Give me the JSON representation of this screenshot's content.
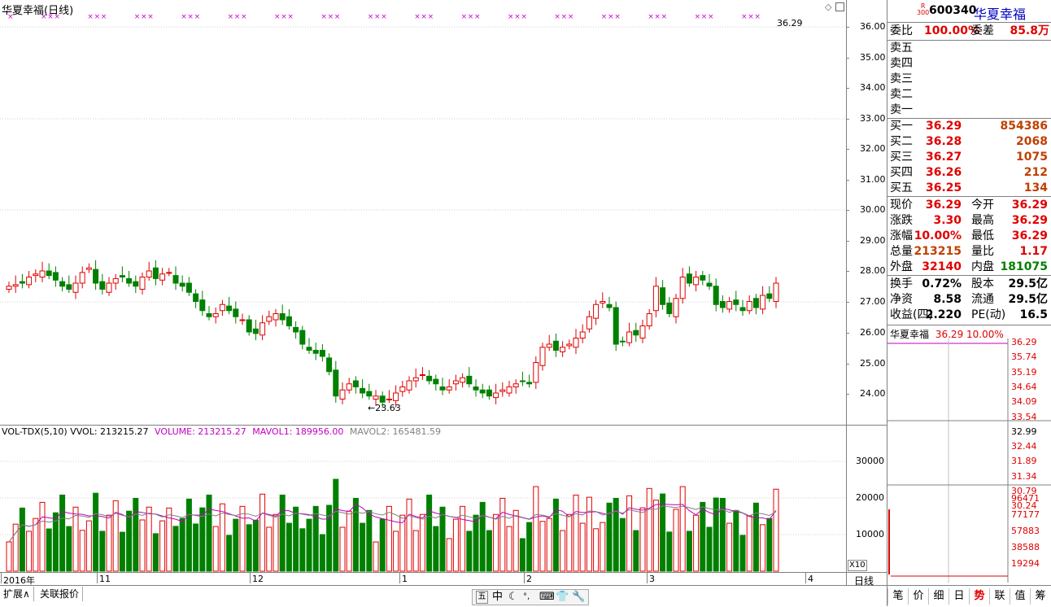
{
  "chart_title": "华夏幸福(日线)",
  "price_axis": [
    "36.00",
    "35.00",
    "34.00",
    "33.00",
    "32.00",
    "31.00",
    "30.00",
    "29.00",
    "28.00",
    "27.00",
    "26.00",
    "25.00",
    "24.00"
  ],
  "vol_axis": [
    "30000",
    "20000",
    "10000"
  ],
  "vol_scale_label": "X10",
  "hi_label": "36.29",
  "lo_label": "←23.63",
  "vol_indicator": {
    "name": "VOL-TDX(5,10)",
    "vvol": "VVOL: 213215.27",
    "volume": "VOLUME: 213215.27",
    "mavol1": "MAVOL1: 189956.00",
    "mavol2": "MAVOL2: 165481.59"
  },
  "x_labels": [
    "2016年",
    "11",
    "12",
    "1",
    "2",
    "3",
    "4"
  ],
  "period_label": "日线",
  "bottom_tabs": [
    "扩展∧",
    "关联报价"
  ],
  "toolbar_icons": [
    "五",
    "中",
    "moon",
    "dots",
    "keyboard",
    "shirt",
    "wrench"
  ],
  "panel": {
    "code": "600340",
    "name": "华夏幸福",
    "badge_top": "R",
    "badge_bot": "300",
    "weibi_label": "委比",
    "weibi": "100.00%",
    "weicha_label": "委差",
    "weicha": "85.8万",
    "sell": [
      {
        "l": "卖五"
      },
      {
        "l": "卖四"
      },
      {
        "l": "卖三"
      },
      {
        "l": "卖二"
      },
      {
        "l": "卖一"
      }
    ],
    "buy": [
      {
        "l": "买一",
        "p": "36.29",
        "v": "854386"
      },
      {
        "l": "买二",
        "p": "36.28",
        "v": "2068"
      },
      {
        "l": "买三",
        "p": "36.27",
        "v": "1075"
      },
      {
        "l": "买四",
        "p": "36.26",
        "v": "212"
      },
      {
        "l": "买五",
        "p": "36.25",
        "v": "134"
      }
    ],
    "quote": [
      {
        "l1": "现价",
        "v1": "36.29",
        "l2": "今开",
        "v2": "36.29"
      },
      {
        "l1": "涨跌",
        "v1": "3.30",
        "l2": "最高",
        "v2": "36.29"
      },
      {
        "l1": "涨幅",
        "v1": "10.00%",
        "l2": "最低",
        "v2": "36.29"
      },
      {
        "l1": "总量",
        "v1": "213215",
        "l2": "量比",
        "v2": "1.17"
      },
      {
        "l1": "外盘",
        "v1": "32140",
        "l2": "内盘",
        "v2": "181075"
      }
    ],
    "fund": [
      {
        "l1": "换手",
        "v1": "0.72%",
        "l2": "股本",
        "v2": "29.5亿"
      },
      {
        "l1": "净资",
        "v1": "8.58",
        "l2": "流通",
        "v2": "29.5亿"
      },
      {
        "l1": "收益(四)",
        "v1": "2.220",
        "l2": "PE(动)",
        "v2": "16.5"
      }
    ],
    "mini_title": "华夏幸福",
    "mini_price": "36.29",
    "mini_pct": "10.00%",
    "mini_axis": [
      "36.29",
      "35.74",
      "35.19",
      "34.64",
      "34.09",
      "33.54",
      "32.99",
      "32.44",
      "31.89",
      "31.34",
      "30.79",
      "30.24"
    ],
    "mini_vol_axis": [
      "96471",
      "77177",
      "57883",
      "38588",
      "19294"
    ],
    "tabs": [
      "笔",
      "价",
      "细",
      "日",
      "势",
      "联",
      "值",
      "筹"
    ]
  }
}
